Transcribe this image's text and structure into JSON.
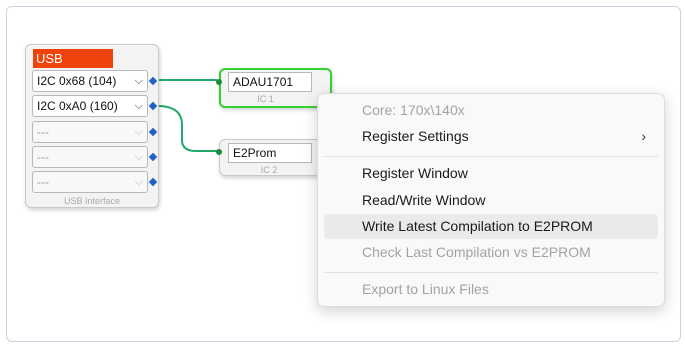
{
  "usb_block": {
    "title": "USB",
    "selects": [
      {
        "value": "I2C 0x68 (104)",
        "enabled": true
      },
      {
        "value": "I2C 0xA0 (160)",
        "enabled": true
      },
      {
        "value": "---",
        "enabled": false
      },
      {
        "value": "---",
        "enabled": false
      },
      {
        "value": "---",
        "enabled": false
      }
    ],
    "footer": "USB Interface"
  },
  "ic1": {
    "name": "ADAU1701",
    "footer": "IC 1"
  },
  "ic2": {
    "name": "E2Prom",
    "footer": "IC 2"
  },
  "context_menu": {
    "header": "Core: 170x\\140x",
    "items": [
      {
        "label": "Register Settings",
        "submenu": true
      },
      {
        "label": "Register Window"
      },
      {
        "label": "Read/Write Window"
      },
      {
        "label": "Write Latest Compilation to E2PROM"
      },
      {
        "label": "Check Last Compilation vs E2PROM"
      },
      {
        "label": "Export to Linux Files"
      }
    ],
    "submenu_glyph": "›"
  },
  "colors": {
    "usb_title_bg": "#f0420b",
    "wire": "#23a86b",
    "selected_border": "#37d12f",
    "pin": "#1f60c9"
  }
}
